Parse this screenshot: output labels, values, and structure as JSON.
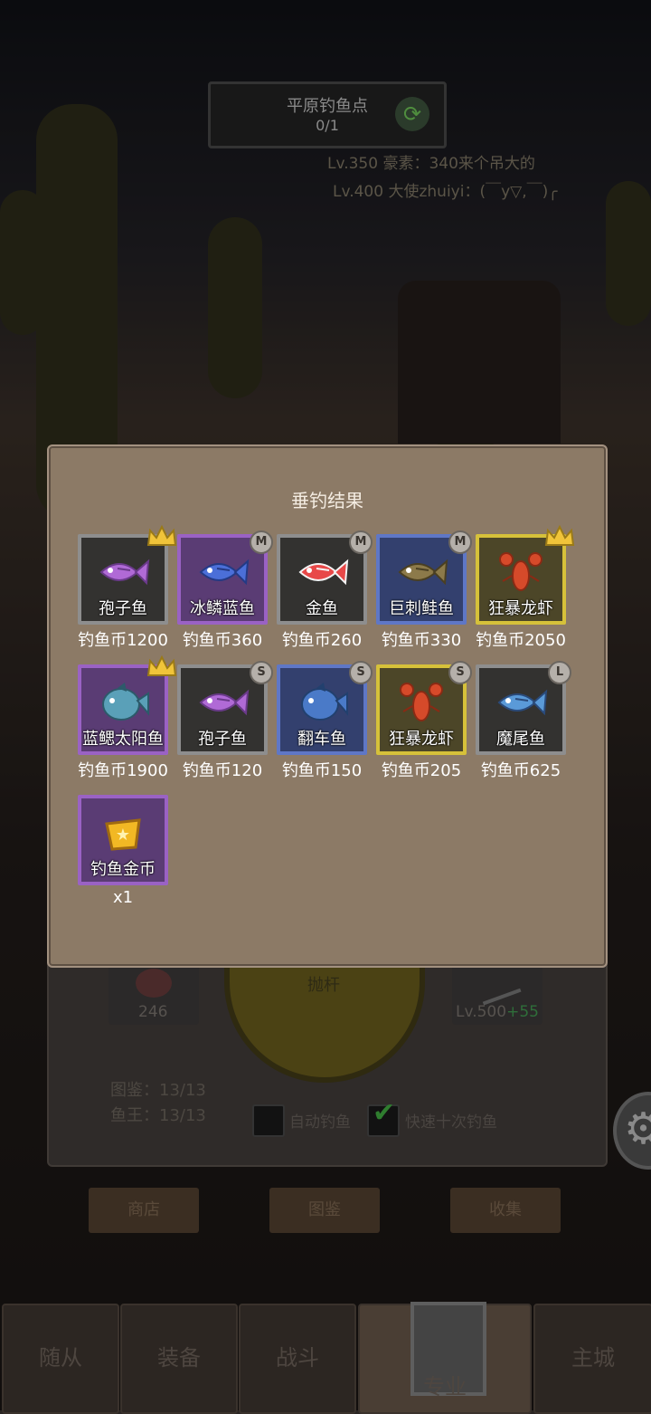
{
  "spot": {
    "name": "平原钓鱼点",
    "count": "0/1",
    "refresh_icon": "refresh-icon"
  },
  "broadcasts": [
    "Lv.350 豪素：340来个吊大的",
    "Lv.400 大使zhuiyi：(￣y▽,￣)╭"
  ],
  "background": {
    "bait_count": "246",
    "cast_label": "抛杆",
    "rod_level": "Lv.500",
    "rod_bonus": "+55",
    "codex_stat": "图鉴：13/13",
    "king_stat": "鱼王：13/13",
    "auto_fish_label": "自动钓鱼",
    "fast_ten_label": "快速十次钓鱼",
    "fast_ten_checked": true,
    "auto_fish_checked": false,
    "buttons": [
      "商店",
      "图鉴",
      "收集"
    ]
  },
  "nav": [
    "随从",
    "装备",
    "战斗",
    "专业",
    "主城"
  ],
  "nav_active": "专业",
  "modal": {
    "title": "垂钓结果",
    "items": [
      {
        "name": "孢子鱼",
        "price": "钓鱼币1200",
        "frame": "gray",
        "tag": "crown",
        "icon": "spore-fish-icon"
      },
      {
        "name": "冰鳞蓝鱼",
        "price": "钓鱼币360",
        "frame": "purple",
        "tag": "M",
        "icon": "blue-fish-icon"
      },
      {
        "name": "金鱼",
        "price": "钓鱼币260",
        "frame": "gray",
        "tag": "M",
        "icon": "goldfish-icon"
      },
      {
        "name": "巨刺鲑鱼",
        "price": "钓鱼币330",
        "frame": "blue",
        "tag": "M",
        "icon": "spiny-salmon-icon"
      },
      {
        "name": "狂暴龙虾",
        "price": "钓鱼币2050",
        "frame": "yellow",
        "tag": "crown",
        "icon": "lobster-icon"
      },
      {
        "name": "蓝鳃太阳鱼",
        "price": "钓鱼币1900",
        "frame": "purple",
        "tag": "crown",
        "icon": "sunfish-icon"
      },
      {
        "name": "孢子鱼",
        "price": "钓鱼币120",
        "frame": "gray",
        "tag": "S",
        "icon": "spore-fish-icon"
      },
      {
        "name": "翻车鱼",
        "price": "钓鱼币150",
        "frame": "blue",
        "tag": "S",
        "icon": "ocean-sunfish-icon"
      },
      {
        "name": "狂暴龙虾",
        "price": "钓鱼币205",
        "frame": "yellow",
        "tag": "S",
        "icon": "lobster-icon"
      },
      {
        "name": "魔尾鱼",
        "price": "钓鱼币625",
        "frame": "gray",
        "tag": "L",
        "icon": "magic-tail-fish-icon"
      },
      {
        "name": "钓鱼金币",
        "price": "x1",
        "frame": "purple",
        "tag": "",
        "icon": "fishing-coin-icon"
      }
    ]
  },
  "colors": {
    "price_text": "#ffffff",
    "modal_bg": "#8c7a66",
    "bonus_green": "#2fa84a"
  }
}
